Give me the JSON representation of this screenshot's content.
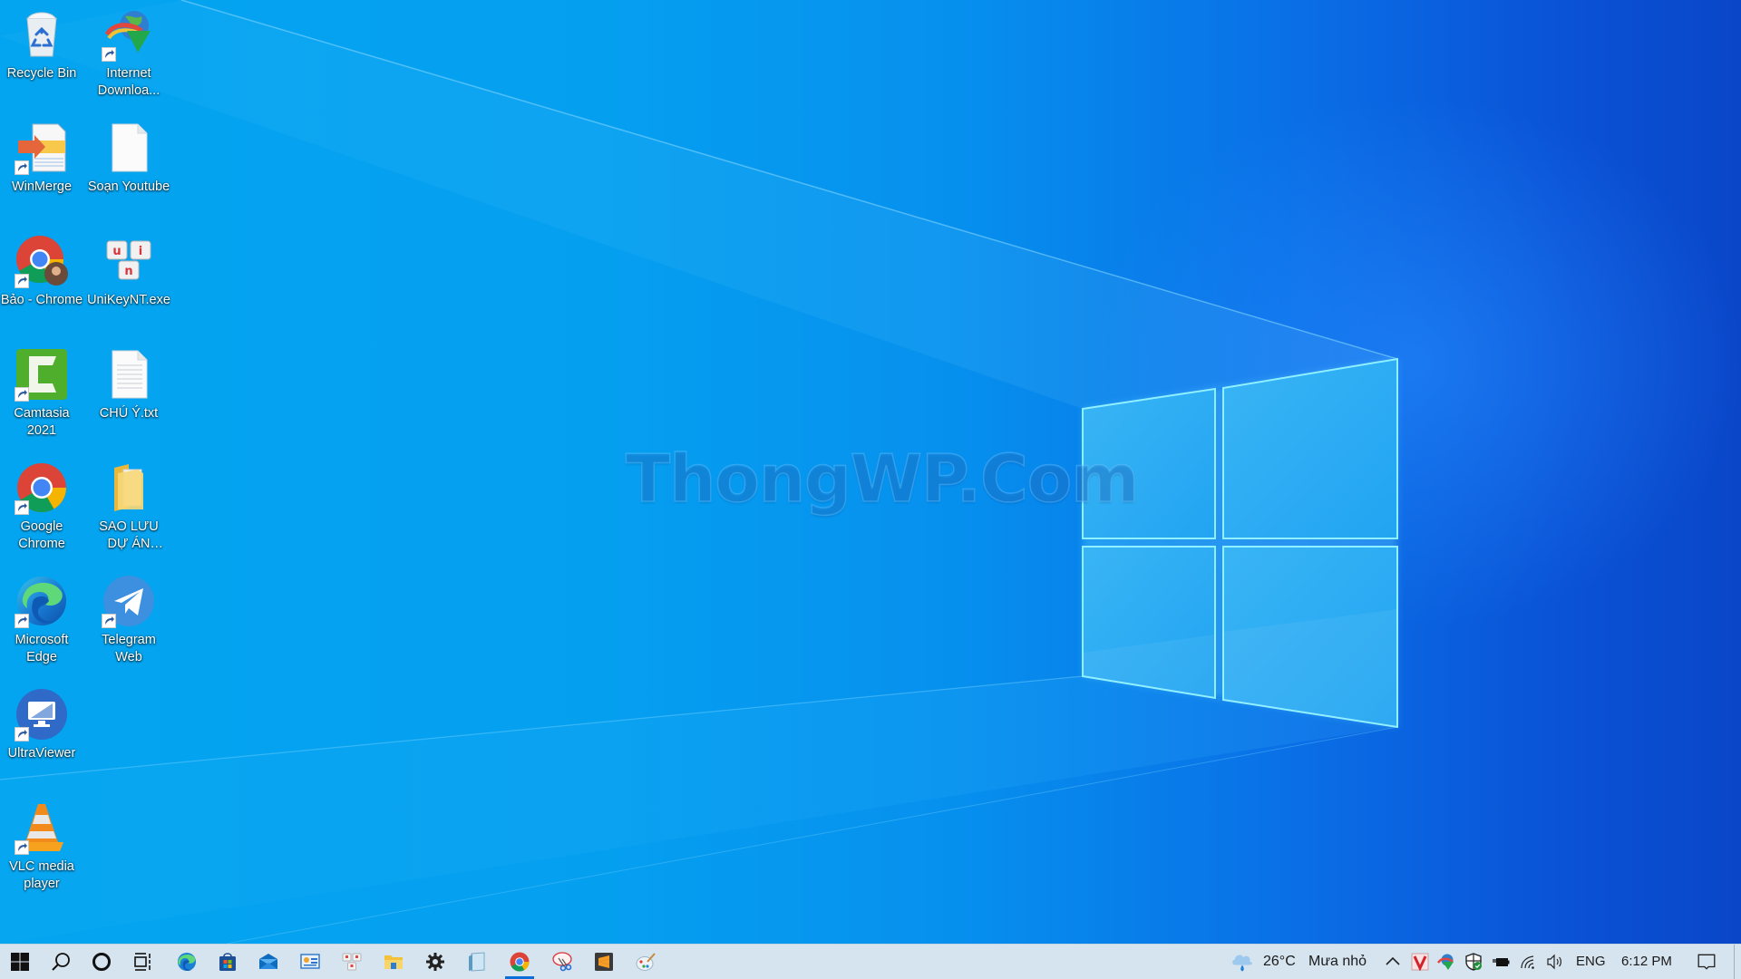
{
  "desktop": {
    "wallpaper": "Windows 10 light blue hero wallpaper",
    "watermark": "ThongWP.Com",
    "colors": {
      "wallpaper_light": "#04a5f0",
      "wallpaper_dark": "#0a46c8",
      "taskbar_bg": "#d6e4ef",
      "active_indicator": "#0a6fd8"
    },
    "icons": [
      {
        "label": "Recycle Bin",
        "icon": "recycle-bin-icon",
        "shortcut": false
      },
      {
        "label": "Internet Downloa...",
        "icon": "internet-download-manager-icon",
        "shortcut": true
      },
      {
        "label": "WinMerge",
        "icon": "winmerge-icon",
        "shortcut": true
      },
      {
        "label": "Soạn Youtube",
        "icon": "blank-file-icon",
        "shortcut": false
      },
      {
        "label": "Bảo - Chrome",
        "icon": "chrome-profile-icon",
        "shortcut": true
      },
      {
        "label": "UniKeyNT.exe",
        "icon": "unikey-icon",
        "shortcut": false
      },
      {
        "label": "Camtasia 2021",
        "icon": "camtasia-icon",
        "shortcut": true
      },
      {
        "label": "CHÚ Ý.txt",
        "icon": "text-file-icon",
        "shortcut": false
      },
      {
        "label": "Google Chrome",
        "icon": "chrome-icon",
        "shortcut": true
      },
      {
        "label": "SAO LƯU DỰ ÁN YOUTUBE",
        "icon": "folder-icon",
        "shortcut": false
      },
      {
        "label": "Microsoft Edge",
        "icon": "edge-icon",
        "shortcut": true
      },
      {
        "label": "Telegram Web",
        "icon": "telegram-icon",
        "shortcut": true
      },
      {
        "label": "UltraViewer",
        "icon": "ultraviewer-icon",
        "shortcut": true
      },
      {
        "label": "VLC media player",
        "icon": "vlc-icon",
        "shortcut": true
      }
    ]
  },
  "taskbar": {
    "start": "start-button",
    "search": "search-button",
    "cortana": "cortana-button",
    "task_view": "task-view-button",
    "pinned": [
      {
        "name": "Microsoft Edge",
        "icon": "edge-icon"
      },
      {
        "name": "Microsoft Store",
        "icon": "store-icon"
      },
      {
        "name": "Mail",
        "icon": "mail-icon"
      },
      {
        "name": "Control Panel",
        "icon": "control-panel-icon"
      },
      {
        "name": "UniKey",
        "icon": "unikey-icon"
      },
      {
        "name": "File Explorer",
        "icon": "file-explorer-icon"
      },
      {
        "name": "Settings",
        "icon": "gear-icon"
      },
      {
        "name": "Notepad",
        "icon": "notepad-icon"
      },
      {
        "name": "Google Chrome",
        "icon": "chrome-icon",
        "active": true
      },
      {
        "name": "Snipping Tool",
        "icon": "snipping-tool-icon"
      },
      {
        "name": "Sublime Text",
        "icon": "sublime-text-icon"
      },
      {
        "name": "Paint",
        "icon": "paint-icon"
      }
    ],
    "tray": {
      "weather_temp": "26°C",
      "weather_desc": "Mưa nhỏ",
      "language": "ENG",
      "time": "6:12 PM",
      "icons": [
        "show-hidden-icons-chevron",
        "v-antivirus-icon",
        "idm-tray-icon",
        "windows-security-icon",
        "battery-charging-icon",
        "wifi-icon",
        "volume-icon"
      ],
      "notification": "action-center-icon"
    }
  }
}
